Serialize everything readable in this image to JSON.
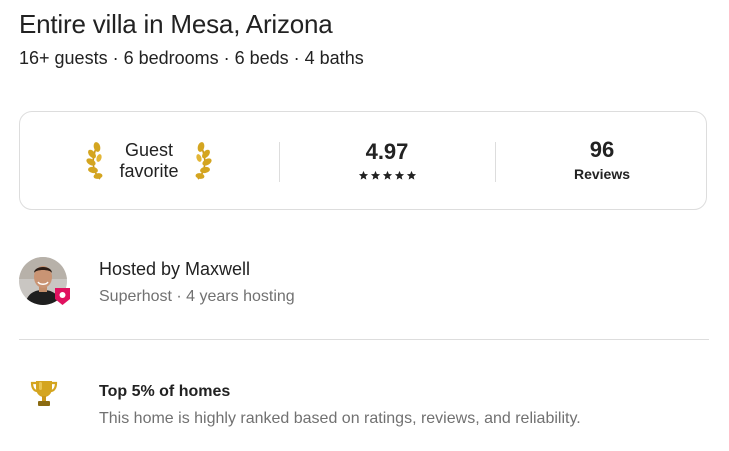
{
  "listing": {
    "title": "Entire villa in Mesa, Arizona",
    "summary": "16+ guests · 6 bedrooms · 6 beds · 4 baths"
  },
  "stats": {
    "guest_favorite_line1": "Guest",
    "guest_favorite_line2": "favorite",
    "rating": "4.97",
    "star_count": 5,
    "reviews_count": "96",
    "reviews_label": "Reviews"
  },
  "host": {
    "hosted_by": "Hosted by Maxwell",
    "meta": "Superhost · 4 years hosting",
    "badge_color": "#e0115f"
  },
  "highlight": {
    "icon": "trophy-icon",
    "title": "Top 5% of homes",
    "description": "This home is highly ranked based on ratings, reviews, and reliability."
  },
  "colors": {
    "laurel_gold": "#d4a520",
    "text_primary": "#222222",
    "text_secondary": "#717171",
    "border": "#dddddd"
  }
}
